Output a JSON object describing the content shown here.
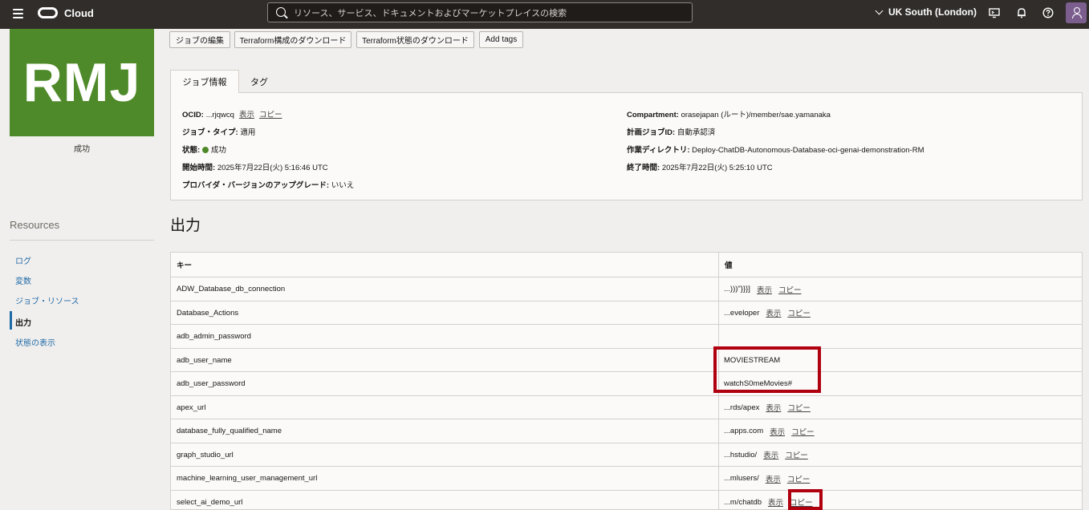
{
  "topbar": {
    "brand": "Cloud",
    "search_placeholder": "リソース、サービス、ドキュメントおよびマーケットプレイスの検索",
    "region": "UK South (London)"
  },
  "sidebar": {
    "badge_text": "RMJ",
    "status": "成功",
    "resources_title": "Resources",
    "items": [
      {
        "label": "ログ"
      },
      {
        "label": "変数"
      },
      {
        "label": "ジョブ・リソース"
      },
      {
        "label": "出力"
      },
      {
        "label": "状態の表示"
      }
    ]
  },
  "actions": {
    "edit": "ジョブの編集",
    "download_config": "Terraform構成のダウンロード",
    "download_state": "Terraform状態のダウンロード",
    "add_tags": "Add tags"
  },
  "tabs": [
    {
      "label": "ジョブ情報"
    },
    {
      "label": "タグ"
    }
  ],
  "job_info": {
    "ocid_label": "OCID:",
    "ocid_value": "...rjqwcq",
    "show": "表示",
    "copy": "コピー",
    "job_type_label": "ジョブ・タイプ:",
    "job_type_value": "適用",
    "state_label": "状態:",
    "state_value": "成功",
    "start_label": "開始時間:",
    "start_value": "2025年7月22日(火) 5:16:46 UTC",
    "upgrade_label": "プロバイダ・バージョンのアップグレード:",
    "upgrade_value": "いいえ",
    "compartment_label": "Compartment:",
    "compartment_value": "orasejapan (ルート)/member/sae.yamanaka",
    "plan_label": "計画ジョブID:",
    "plan_value": "自動承認済",
    "workdir_label": "作業ディレクトリ:",
    "workdir_value": "Deploy-ChatDB-Autonomous-Database-oci-genai-demonstration-RM",
    "end_label": "終了時間:",
    "end_value": "2025年7月22日(火) 5:25:10 UTC"
  },
  "outputs": {
    "title": "出力",
    "col_key": "キー",
    "col_value": "値",
    "show": "表示",
    "copy": "コピー",
    "rows": [
      {
        "key": "ADW_Database_db_connection",
        "value": "...)))\"}}}]",
        "links": true
      },
      {
        "key": "Database_Actions",
        "value": "...eveloper",
        "links": true
      },
      {
        "key": "adb_admin_password",
        "value": "",
        "links": false
      },
      {
        "key": "adb_user_name",
        "value": "MOVIESTREAM",
        "links": false
      },
      {
        "key": "adb_user_password",
        "value": "watchS0meMovies#",
        "links": false
      },
      {
        "key": "apex_url",
        "value": "...rds/apex",
        "links": true
      },
      {
        "key": "database_fully_qualified_name",
        "value": "...apps.com",
        "links": true
      },
      {
        "key": "graph_studio_url",
        "value": "...hstudio/",
        "links": true
      },
      {
        "key": "machine_learning_user_management_url",
        "value": "...mlusers/",
        "links": true
      },
      {
        "key": "select_ai_demo_url",
        "value": "...m/chatdb",
        "links": true
      }
    ]
  },
  "colors": {
    "header_bg": "#312d2a",
    "badge_green": "#4f8a2a",
    "link_blue": "#1e6aa8",
    "highlight_red": "#b0000f"
  }
}
